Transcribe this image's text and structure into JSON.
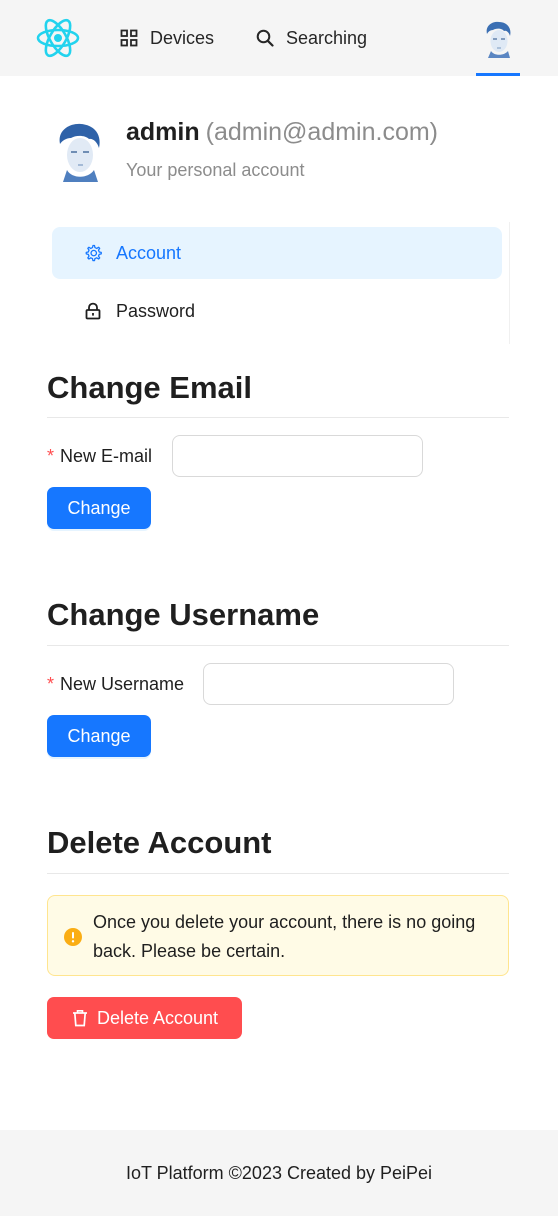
{
  "header": {
    "logo_icon": "react-atom-logo-icon",
    "nav": [
      {
        "label": "Devices",
        "icon": "grid-icon"
      },
      {
        "label": "Searching",
        "icon": "search-icon"
      }
    ],
    "avatar_icon": "user-avatar",
    "accent": "#1677ff"
  },
  "profile": {
    "username": "admin",
    "email": "(admin@admin.com)",
    "subtitle": "Your personal account"
  },
  "menu": {
    "items": [
      {
        "label": "Account",
        "icon": "gear-icon",
        "selected": true
      },
      {
        "label": "Password",
        "icon": "lock-icon",
        "selected": false
      }
    ]
  },
  "change_email": {
    "title": "Change Email",
    "required_mark": "*",
    "label": "New E-mail",
    "value": "",
    "button": "Change"
  },
  "change_username": {
    "title": "Change Username",
    "required_mark": "*",
    "label": "New Username",
    "value": "",
    "button": "Change"
  },
  "delete_account": {
    "title": "Delete Account",
    "warning": "Once you delete your account, there is no going back. Please be certain.",
    "warning_icon": "exclamation-circle-icon",
    "button": "Delete Account",
    "button_icon": "trash-icon",
    "danger_color": "#ff4d4f"
  },
  "footer": {
    "text": "IoT Platform ©2023 Created by PeiPei"
  }
}
